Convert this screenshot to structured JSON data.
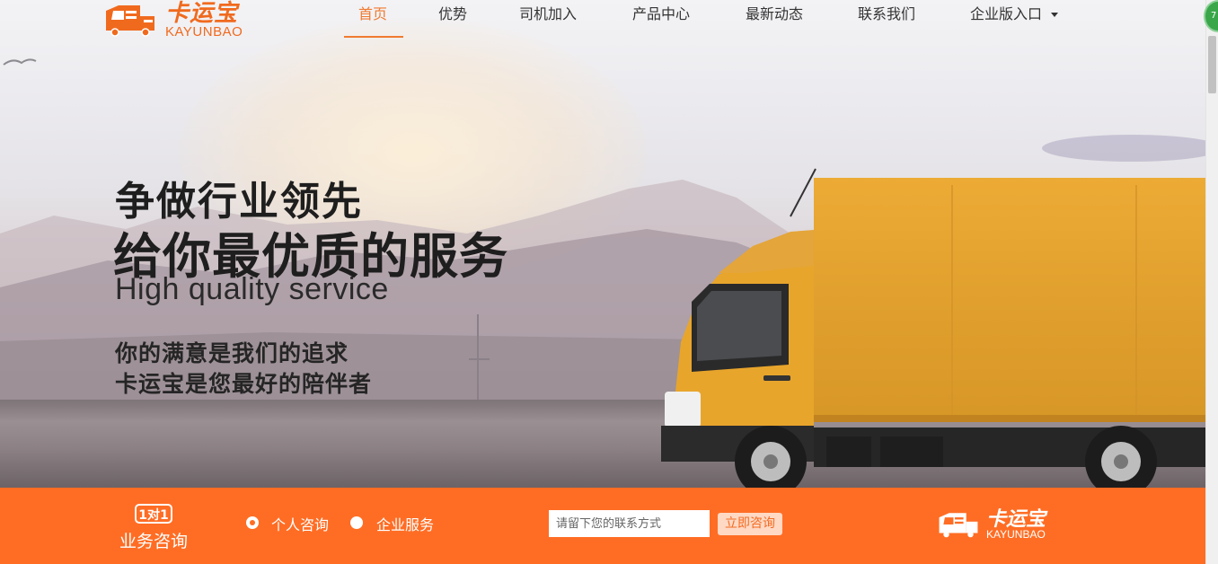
{
  "nav": {
    "logo_cn": "卡运宝",
    "logo_en": "KAYUNBAO",
    "items": [
      {
        "label": "首页",
        "active": true
      },
      {
        "label": "优势"
      },
      {
        "label": "司机加入"
      },
      {
        "label": "产品中心"
      },
      {
        "label": "最新动态"
      },
      {
        "label": "联系我们"
      },
      {
        "label": "企业版入口"
      }
    ]
  },
  "hero": {
    "line1": "争做行业领先",
    "line2": "给你最优质的服务",
    "line3": "High quality service",
    "line4": "你的满意是我们的追求",
    "line5": "卡运宝是您最好的陪伴者"
  },
  "consult_bar": {
    "badge": "1对1",
    "label": "业务咨询",
    "options": [
      {
        "label": "个人咨询",
        "checked": true
      },
      {
        "label": "企业服务",
        "checked": false
      }
    ],
    "input_placeholder": "请留下您的联系方式",
    "submit_label": "立即咨询",
    "logo_cn": "卡运宝",
    "logo_en": "KAYUNBAO"
  },
  "colors": {
    "brand_orange": "#ff6d24",
    "nav_active": "#f07a30",
    "truck_yellow": "#e8a52c"
  },
  "extension_badge": "7"
}
